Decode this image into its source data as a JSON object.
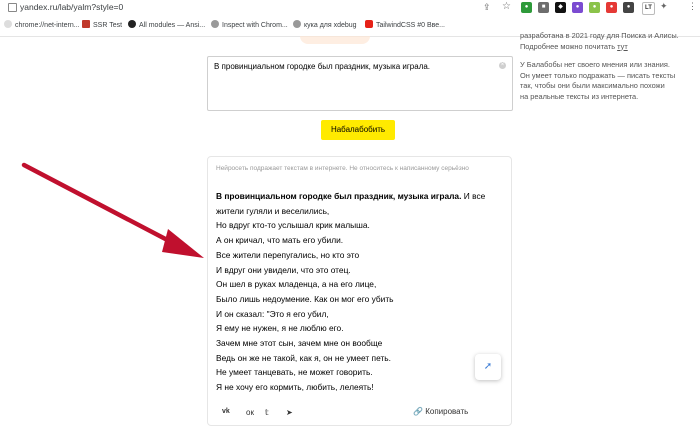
{
  "browser": {
    "url": "yandex.ru/lab/yalm?style=0",
    "bookmarks": [
      {
        "label": "chrome://net-intern...",
        "color": "#888888"
      },
      {
        "label": "SSR Test",
        "color": "#c0392b"
      },
      {
        "label": "All modules — Ansi...",
        "color": "#222222"
      },
      {
        "label": "Inspect with Chrom...",
        "color": "#777777"
      },
      {
        "label": "кука для xdebug",
        "color": "#777777"
      },
      {
        "label": "TailwindCSS #0 Вве...",
        "color": "#e62117"
      }
    ]
  },
  "input": {
    "value": "В провинциальном городке был праздник, музыка играла."
  },
  "generate_button": "Набалабобить",
  "result": {
    "disclaimer": "Нейросеть подражает текстам в интернете. Не относитесь к написанному серьёзно",
    "lead": "В провинциальном городке был праздник, музыка играла.",
    "lines": [
      " И все жители гуляли и веселились,",
      "Но вдруг кто-то услышал крик малыша.",
      "А он кричал, что мать его убили.",
      "Все жители перепугались, но кто это",
      "И вдруг они увидели, что это отец.",
      "Он шел в руках младенца, а на его лице,",
      "Было лишь недоумение. Как он мог его убить",
      "И он сказал: \"Это я его убил,",
      "Я ему не нужен, я не люблю его.",
      "Зачем мне этот сын, зачем мне он вообще",
      "Ведь он же не такой, как я, он не умеет петь.",
      "Не умеет танцевать, не может говорить.",
      "Я не хочу его кормить, любить, лелеять!"
    ],
    "copy_label": "Копировать"
  },
  "sidebar": {
    "p1_line1": "разработана в 2021 году для Поиска и Алисы.",
    "p1_line2": "Подробнее можно почитать ",
    "p1_link": "тут",
    "p2_line1": "У Балабобы нет своего мнения или знания.",
    "p2_line2": "Он умеет только подражать — писать тексты",
    "p2_line3": "так, чтобы они были максимально похожи",
    "p2_line4": "на реальные тексты из интернета."
  },
  "colors": {
    "accent_button": "#ffea00",
    "arrow": "#c0102e"
  }
}
